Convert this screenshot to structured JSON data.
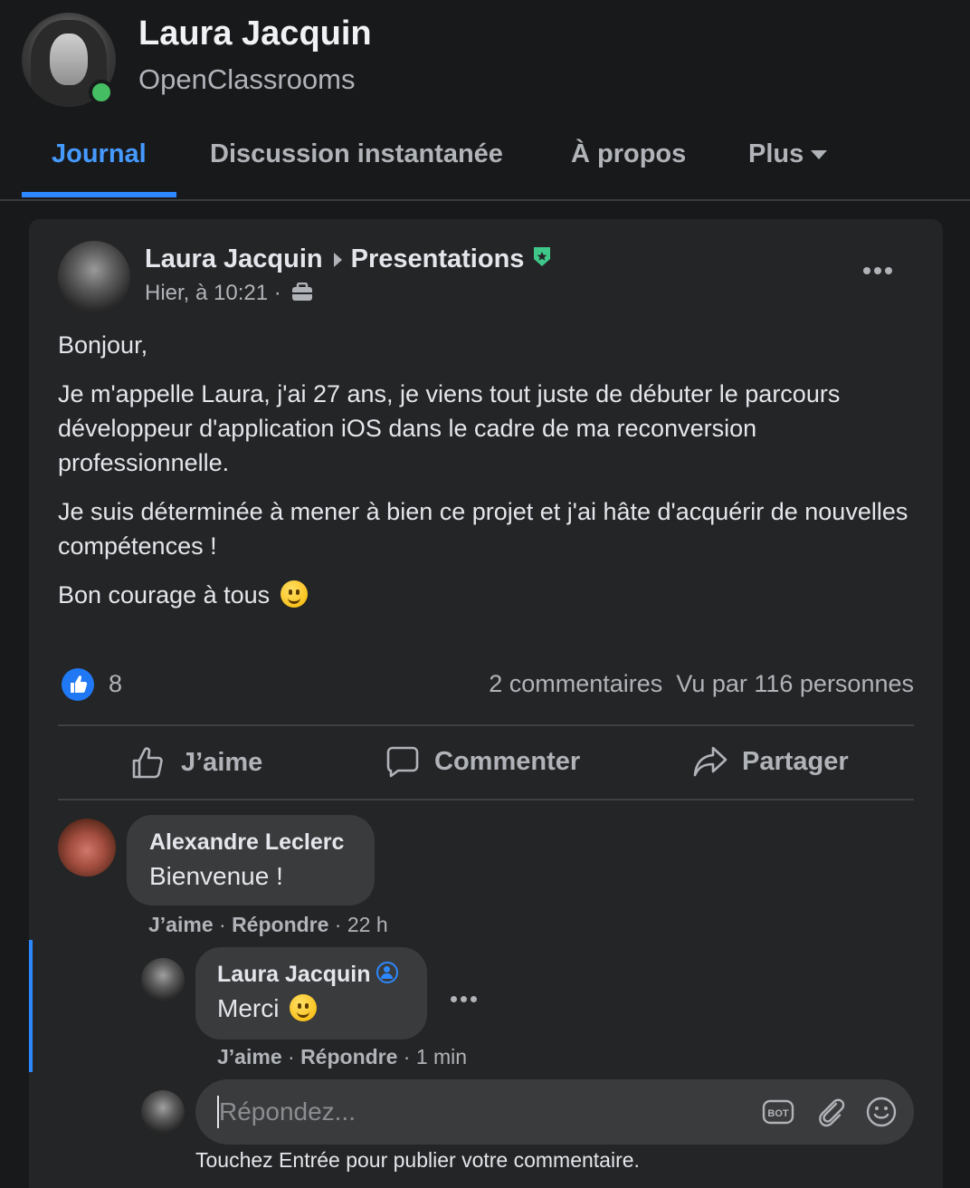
{
  "profile": {
    "name": "Laura Jacquin",
    "organization": "OpenClassrooms",
    "online": true
  },
  "tabs": [
    {
      "label": "Journal",
      "active": true
    },
    {
      "label": "Discussion instantanée",
      "active": false
    },
    {
      "label": "À propos",
      "active": false
    },
    {
      "label": "Plus",
      "active": false
    }
  ],
  "post": {
    "author": "Laura Jacquin",
    "group": "Presentations",
    "time": "Hier, à 10:21 ·",
    "paragraphs": [
      "Bonjour,",
      "Je m'appelle Laura, j'ai 27 ans, je viens tout juste de débuter le parcours développeur d'application iOS dans le cadre de ma reconversion professionnelle.",
      "Je suis déterminée à mener à bien ce projet et j'ai hâte d'acquérir de nouvelles compétences !",
      "Bon courage à tous"
    ],
    "like_count": "8",
    "comments_count": "2 commentaires",
    "views": "Vu par 116 personnes"
  },
  "actions": {
    "like": "J’aime",
    "comment": "Commenter",
    "share": "Partager"
  },
  "comments": [
    {
      "author": "Alexandre Leclerc",
      "text": "Bienvenue !",
      "like": "J’aime",
      "reply": "Répondre",
      "time": "· 22 h"
    }
  ],
  "reply": {
    "author": "Laura Jacquin",
    "text": "Merci",
    "like": "J’aime",
    "reply": "Répondre",
    "time": "· 1 min"
  },
  "reply_box": {
    "placeholder": "Répondez...",
    "hint": "Touchez Entrée pour publier votre commentaire.",
    "bot_label": "BOT"
  },
  "colors": {
    "background": "#18191a",
    "card": "#242526",
    "accent": "#2d88ff",
    "online": "#45bd62",
    "badge": "#3fc88a"
  }
}
